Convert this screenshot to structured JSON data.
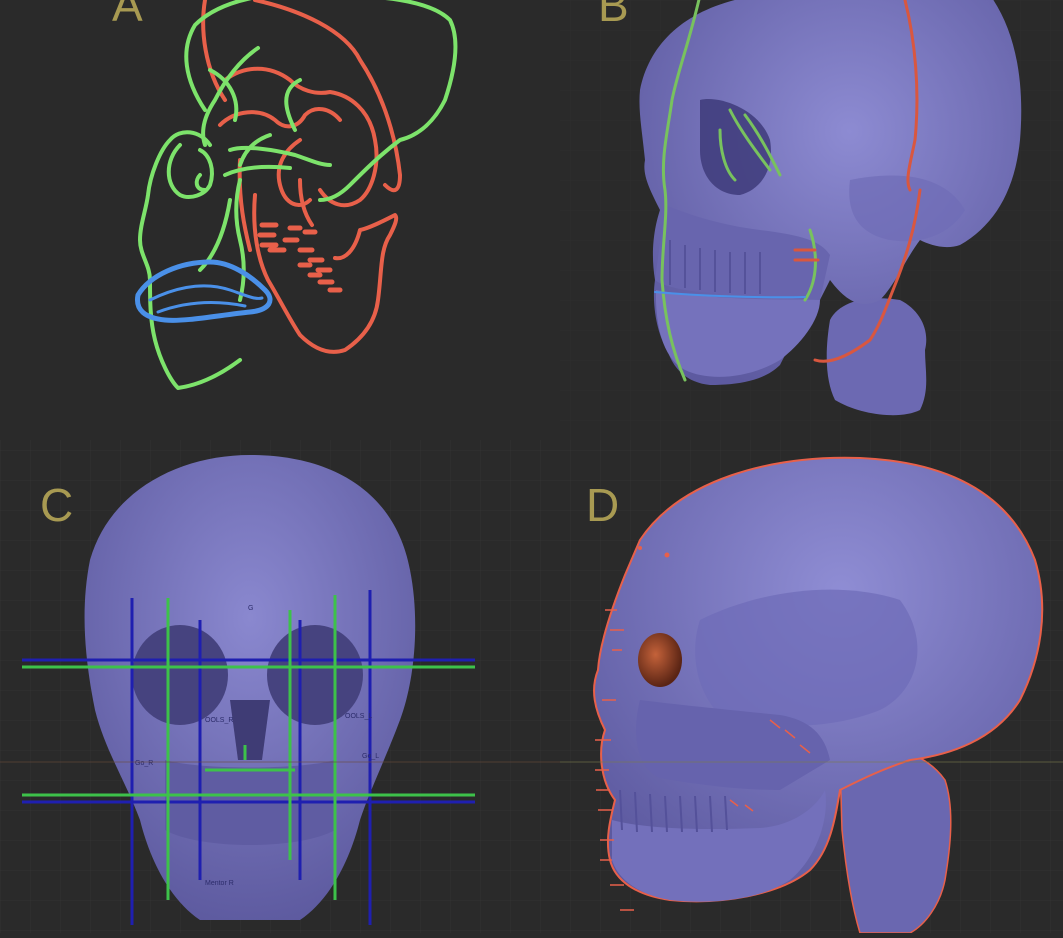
{
  "panels": {
    "a": {
      "label": "A"
    },
    "b": {
      "label": "B"
    },
    "c": {
      "label": "C"
    },
    "d": {
      "label": "D"
    }
  },
  "colors": {
    "background": "#2a2a2a",
    "grid": "#3a3a3a",
    "skull": "#7a77bf",
    "skull_shade": "#5f5ca4",
    "skull_light": "#9290d6",
    "green_contour": "#7de36b",
    "red_contour": "#e8604a",
    "blue_contour": "#4a90e8",
    "guide_blue": "#1a1aa8",
    "guide_green": "#3dc24a",
    "label": "#a89a52"
  },
  "landmarks_c": [
    "G",
    "OOLS_R",
    "OOLS_L",
    "Go_R",
    "Go_L",
    "Mentor R"
  ]
}
